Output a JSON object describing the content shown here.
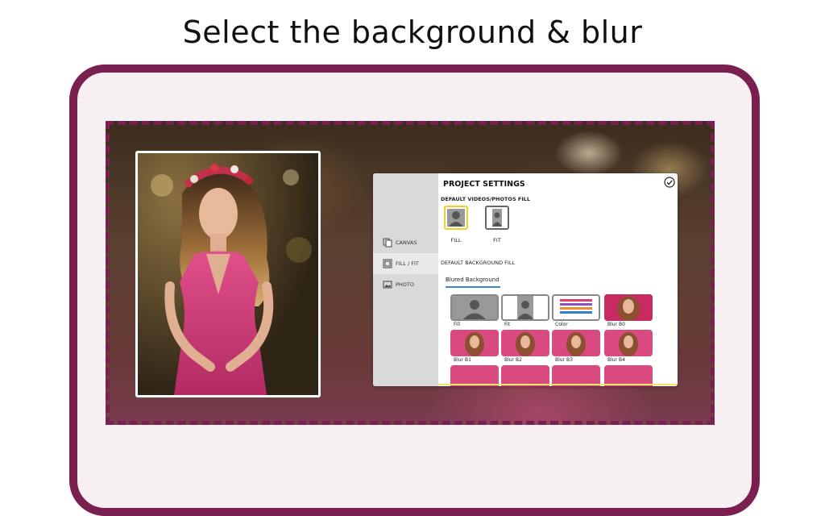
{
  "headline": "Select the background & blur",
  "panel": {
    "title": "PROJECT SETTINGS",
    "sidebar": [
      {
        "label": "CANVAS",
        "icon": "canvas-icon"
      },
      {
        "label": "FILL / FIT",
        "icon": "fill-fit-icon"
      },
      {
        "label": "PHOTO",
        "icon": "photo-icon"
      }
    ],
    "default_fill_label": "DEFAULT VIDEOS/PHOTOS FILL",
    "fill_options": [
      {
        "label": "FILL",
        "selected": true
      },
      {
        "label": "FIT",
        "selected": false
      }
    ],
    "background_fill_label": "DEFAULT BACKGROUND FILL",
    "tab": "Blured Background",
    "backgrounds": [
      "Fill",
      "Fit",
      "Color",
      "Blur B0",
      "Blur B1",
      "Blur B2",
      "Blur B3",
      "Blur B4"
    ]
  },
  "colors": {
    "frame": "#7a2050",
    "selection": "#f2d024",
    "tab_underline": "#3a8ad0"
  }
}
